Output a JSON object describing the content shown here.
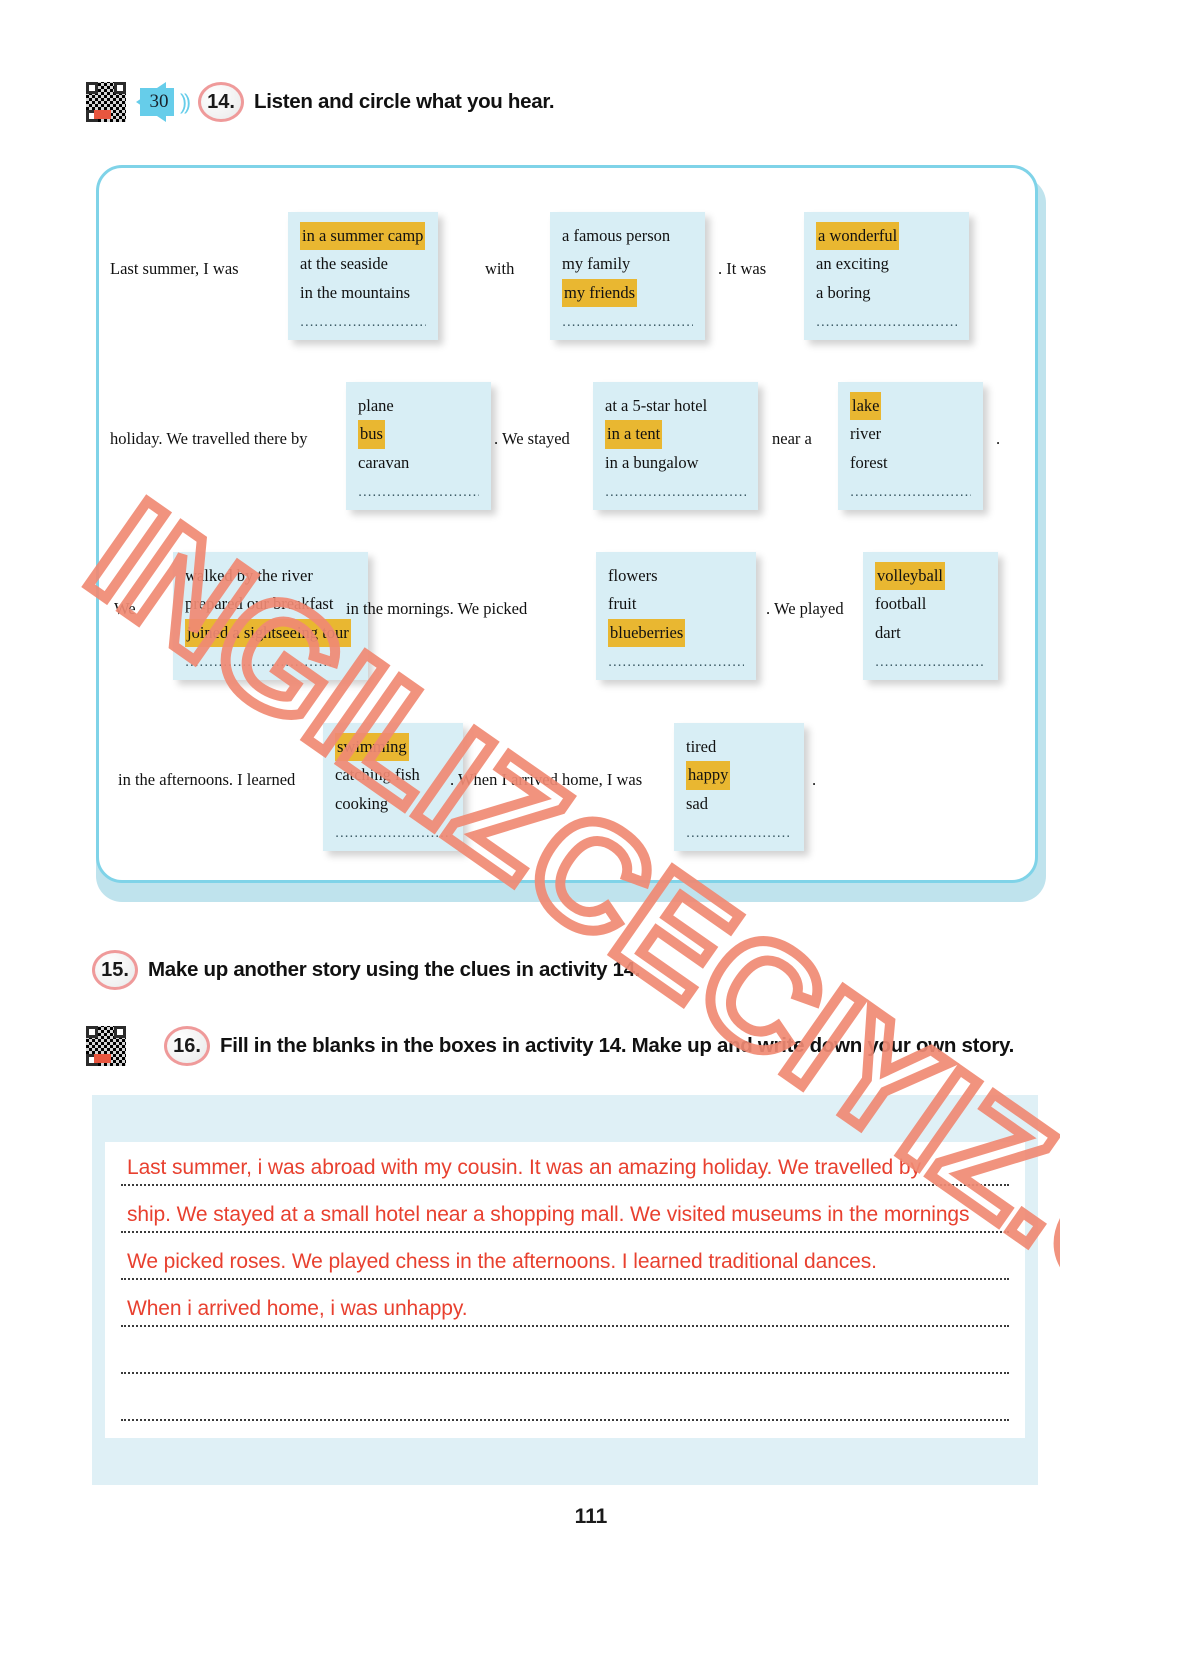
{
  "page": {
    "number": "111"
  },
  "watermark": {
    "text": "INGILIZCECIYIZ.COM"
  },
  "activity14": {
    "number": "14.",
    "title": "Listen and circle what you hear.",
    "audio_track": "30",
    "icons": {
      "qr": "qr-code-icon",
      "speaker": "speaker-icon",
      "waves": "))"
    },
    "dots": "...............................",
    "lines": [
      {
        "lead": "Last summer, I was",
        "box1": {
          "options": [
            "in a summer camp",
            "at the seaside",
            "in the mountains"
          ],
          "highlighted": "in a summer camp"
        },
        "mid1": "with",
        "box2": {
          "options": [
            "a famous person",
            "my family",
            "my friends"
          ],
          "highlighted": "my friends"
        },
        "mid2": ".    It was",
        "box3": {
          "options": [
            "a wonderful",
            "an exciting",
            "a boring"
          ],
          "highlighted": "a wonderful"
        }
      },
      {
        "lead": "holiday. We travelled there by",
        "box1": {
          "options": [
            "plane",
            "bus",
            "caravan"
          ],
          "highlighted": "bus"
        },
        "mid1": ". We stayed",
        "box2": {
          "options": [
            "at a 5-star hotel",
            "in a tent",
            "in a bungalow"
          ],
          "highlighted": "in a tent"
        },
        "mid2": "near a",
        "box3": {
          "options": [
            "lake",
            "river",
            "forest"
          ],
          "highlighted": "lake"
        },
        "tail": "."
      },
      {
        "lead": "We",
        "box1": {
          "options": [
            "walked by the river",
            "prepared our breakfast",
            "joined a sightseeing tour"
          ],
          "highlighted": "joined a sightseeing tour"
        },
        "mid1": "in the mornings. We picked",
        "box2": {
          "options": [
            "flowers",
            "fruit",
            "blueberries"
          ],
          "highlighted": "blueberries"
        },
        "mid2": ".    We played",
        "box3": {
          "options": [
            "volleyball",
            "football",
            "dart"
          ],
          "highlighted": "volleyball"
        }
      },
      {
        "lead": "in the afternoons. I learned",
        "box1": {
          "options": [
            "swimming",
            "catching fish",
            "cooking"
          ],
          "highlighted": "swimming"
        },
        "mid1": ". When I arrived home, I was",
        "box2": {
          "options": [
            "tired",
            "happy",
            "sad"
          ],
          "highlighted": "happy"
        },
        "tail": "."
      }
    ]
  },
  "activity15": {
    "number": "15.",
    "title": "Make up another story using the clues in activity 14."
  },
  "activity16": {
    "number": "16.",
    "title": "Fill in the blanks in the boxes in activity 14. Make up and write down your own story.",
    "icons": {
      "qr": "qr-code-icon"
    },
    "answer_lines": [
      "Last summer, i was abroad with my cousin. It was an amazing holiday. We travelled by",
      "ship. We stayed at a small hotel near a shopping mall. We visited museums in the mornings",
      "We picked roses. We played chess in the afternoons. I learned traditional dances.",
      "When i arrived home, i was unhappy.",
      "",
      ""
    ]
  },
  "colors": {
    "panel_border": "#7fd3e8",
    "option_box_bg": "#d8eef5",
    "highlight": "#e9b731",
    "handwriting": "#e8402f",
    "number_ring": "#ef9a9a",
    "watermark": "#f08a74"
  }
}
